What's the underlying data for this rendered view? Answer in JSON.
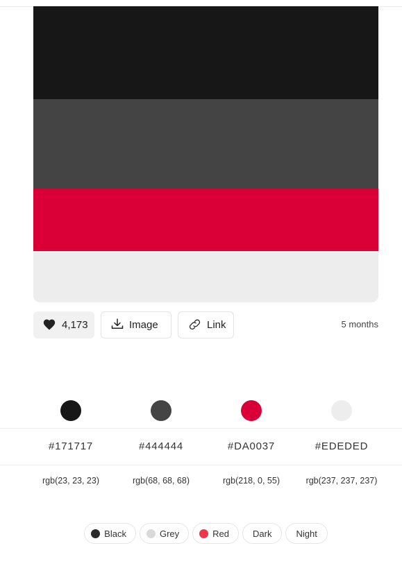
{
  "palette": {
    "swatches": [
      {
        "hex": "#171717",
        "rgb": "rgb(23, 23, 23)"
      },
      {
        "hex": "#444444",
        "rgb": "rgb(68, 68, 68)"
      },
      {
        "hex": "#DA0037",
        "rgb": "rgb(218, 0, 55)"
      },
      {
        "hex": "#EDEDED",
        "rgb": "rgb(237, 237, 237)"
      }
    ]
  },
  "actions": {
    "likes_count": "4,173",
    "image_label": "Image",
    "link_label": "Link",
    "icons": {
      "like": "heart-icon",
      "image": "download-icon",
      "link": "link-icon"
    }
  },
  "meta": {
    "age": "5 months"
  },
  "tags": [
    {
      "label": "Black",
      "color": "#2b2b2b"
    },
    {
      "label": "Grey",
      "color": "#d9d9d9"
    },
    {
      "label": "Red",
      "color": "#f0364b"
    },
    {
      "label": "Dark",
      "color": null
    },
    {
      "label": "Night",
      "color": null
    }
  ]
}
